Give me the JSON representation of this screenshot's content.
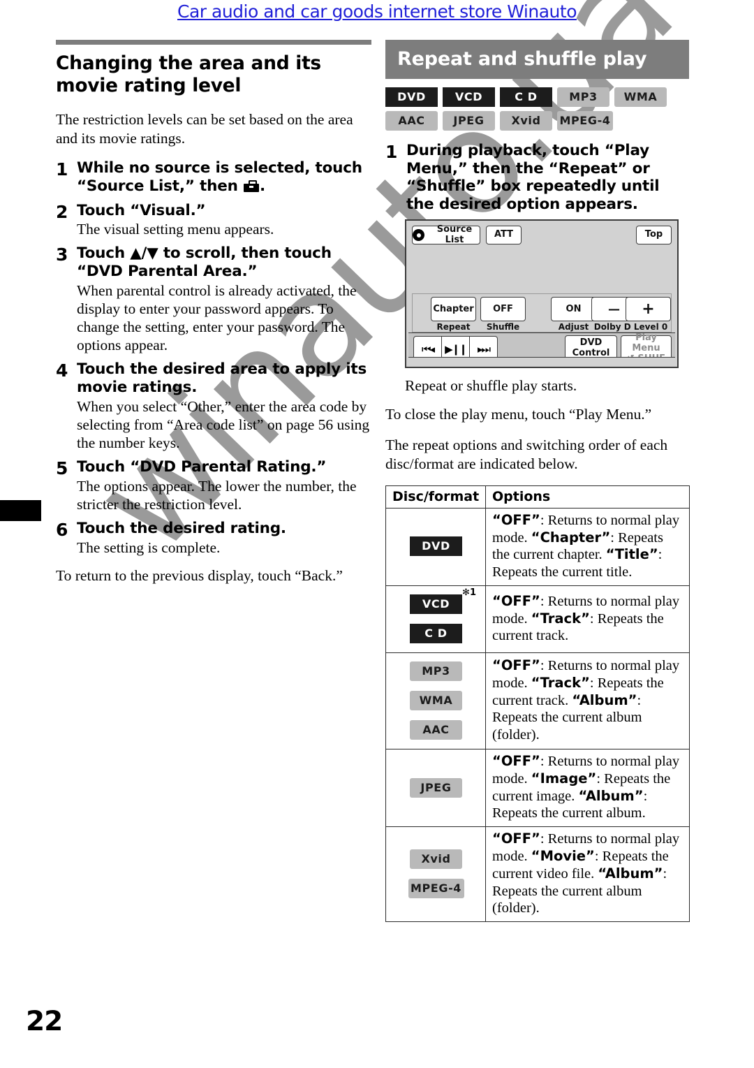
{
  "site_link": "Car audio and car goods internet store Winauto",
  "watermark": "winauto.ua",
  "page_number": "22",
  "left_column": {
    "title": "Changing the area and its movie rating level",
    "intro": "The restriction levels can be set based on the area and its movie ratings.",
    "steps": [
      {
        "num": "1",
        "bold_pre": "While no source is selected, touch “Source List,” then ",
        "bold_post": ".",
        "has_tool_icon": true,
        "sub": ""
      },
      {
        "num": "2",
        "bold_pre": "Touch “Visual.”",
        "bold_post": "",
        "has_tool_icon": false,
        "sub": "The visual setting menu appears."
      },
      {
        "num": "3",
        "bold_pre": "Touch ▲/▼ to scroll, then touch “DVD Parental Area.”",
        "bold_post": "",
        "has_tool_icon": false,
        "sub": "When parental control is already activated, the display to enter your password appears. To change the setting, enter your password. The options appear."
      },
      {
        "num": "4",
        "bold_pre": "Touch the desired area to apply its movie ratings.",
        "bold_post": "",
        "has_tool_icon": false,
        "sub": "When you select “Other,” enter the area code by selecting from “Area code list” on page 56 using the number keys."
      },
      {
        "num": "5",
        "bold_pre": "Touch “DVD Parental Rating.”",
        "bold_post": "",
        "has_tool_icon": false,
        "sub": "The options appear. The lower the number, the stricter the restriction level."
      },
      {
        "num": "6",
        "bold_pre": "Touch the desired rating.",
        "bold_post": "",
        "has_tool_icon": false,
        "sub": "The setting is complete."
      }
    ],
    "closing": "To return to the previous display, touch “Back.”"
  },
  "right_column": {
    "banner_title": "Repeat and shuffle play",
    "format_badges_row1": [
      {
        "label": "DVD",
        "style": "dark"
      },
      {
        "label": "VCD",
        "style": "dark"
      },
      {
        "label": "C D",
        "style": "dark"
      },
      {
        "label": "MP3",
        "style": "light"
      },
      {
        "label": "WMA",
        "style": "light"
      }
    ],
    "format_badges_row2": [
      {
        "label": "AAC",
        "style": "light"
      },
      {
        "label": "JPEG",
        "style": "light"
      },
      {
        "label": "Xvid",
        "style": "light"
      },
      {
        "label": "MPEG-4",
        "style": "light"
      }
    ],
    "step1": {
      "num": "1",
      "text": "During playback, touch “Play Menu,” then the “Repeat” or “Shuffle” box repeatedly until the desired option appears."
    },
    "device": {
      "source_list": "Source List",
      "att": "ATT",
      "top": "Top",
      "repeat_value": "Chapter",
      "repeat_label": "Repeat",
      "shuffle_value": "OFF",
      "shuffle_label": "Shuffle",
      "adjust_value": "ON",
      "adjust_label": "Adjust",
      "minus": "—",
      "plus": "+",
      "dolby_label": "Dolby D Level  0",
      "prev": "⏮◂",
      "playpause": "▶❙❙",
      "next": "▸⏭",
      "dvd_control_line1": "DVD",
      "dvd_control_line2": "Control",
      "play_menu_line1": "Play Menu",
      "play_menu_line2": "↺ SHUF"
    },
    "after_device": [
      "Repeat or shuffle play starts.",
      "To close the play menu, touch “Play Menu.”",
      "The repeat options and switching order of each disc/format are indicated below."
    ],
    "table": {
      "headers": [
        "Disc/format",
        "Options"
      ],
      "rows": [
        {
          "badges": [
            {
              "label": "DVD",
              "style": "dark",
              "footnote": ""
            }
          ],
          "options": [
            {
              "term": "“OFF”",
              "desc": ": Returns to normal play mode."
            },
            {
              "term": "“Chapter”",
              "desc": ": Repeats the current chapter."
            },
            {
              "term": "“Title”",
              "desc": ": Repeats the current title."
            }
          ]
        },
        {
          "badges": [
            {
              "label": "VCD",
              "style": "dark",
              "footnote": "✻1"
            },
            {
              "label": "C D",
              "style": "dark",
              "footnote": ""
            }
          ],
          "options": [
            {
              "term": "“OFF”",
              "desc": ": Returns to normal play mode."
            },
            {
              "term": "“Track”",
              "desc": ": Repeats the current track."
            }
          ]
        },
        {
          "badges": [
            {
              "label": "MP3",
              "style": "light",
              "footnote": ""
            },
            {
              "label": "WMA",
              "style": "light",
              "footnote": ""
            },
            {
              "label": "AAC",
              "style": "light",
              "footnote": ""
            }
          ],
          "options": [
            {
              "term": "“OFF”",
              "desc": ": Returns to normal play mode."
            },
            {
              "term": "“Track”",
              "desc": ": Repeats the current track."
            },
            {
              "term": "“Album”",
              "desc": ": Repeats the current album (folder)."
            }
          ]
        },
        {
          "badges": [
            {
              "label": "JPEG",
              "style": "light",
              "footnote": ""
            }
          ],
          "options": [
            {
              "term": "“OFF”",
              "desc": ": Returns to normal play mode."
            },
            {
              "term": "“Image”",
              "desc": ": Repeats the current image."
            },
            {
              "term": "“Album”",
              "desc": ": Repeats the current album."
            }
          ]
        },
        {
          "badges": [
            {
              "label": "Xvid",
              "style": "light",
              "footnote": ""
            },
            {
              "label": "MPEG-4",
              "style": "light",
              "footnote": ""
            }
          ],
          "options": [
            {
              "term": "“OFF”",
              "desc": ": Returns to normal play mode."
            },
            {
              "term": "“Movie”",
              "desc": ": Repeats the current video file."
            },
            {
              "term": "“Album”",
              "desc": ": Repeats the current album (folder)."
            }
          ]
        }
      ]
    }
  }
}
